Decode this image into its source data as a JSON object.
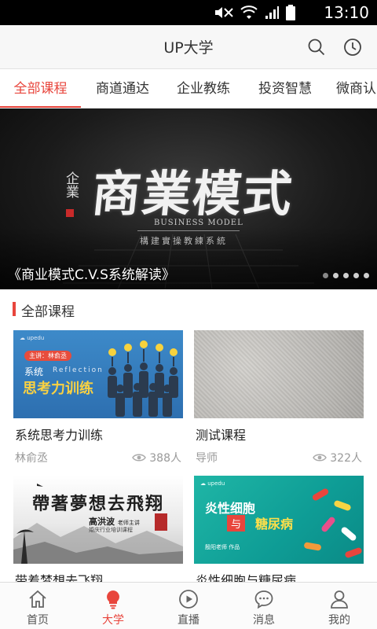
{
  "status_bar": {
    "time": "13:10"
  },
  "app_bar": {
    "title": "UP大学",
    "search_icon": "search-icon",
    "history_icon": "clock-icon"
  },
  "tabs": [
    {
      "label": "全部课程",
      "active": true
    },
    {
      "label": "商道通达",
      "active": false
    },
    {
      "label": "企业教练",
      "active": false
    },
    {
      "label": "投资智慧",
      "active": false
    },
    {
      "label": "微商认",
      "active": false
    }
  ],
  "banner": {
    "calligraphy": "商業模式",
    "brand": "企業",
    "subtitle_en": "BUSINESS MODEL",
    "subtitle_cn": "構建實操教練系統",
    "caption": "《商业模式C.V.S系统解读》",
    "slide_count": 5,
    "active_slide": 1
  },
  "section": {
    "title": "全部课程"
  },
  "courses": [
    {
      "title": "系统思考力训练",
      "author": "林俞丞",
      "views": "388人",
      "thumb": {
        "badge": "主讲：林俞丞",
        "sys": "系统",
        "ref": "Reflection",
        "big": "思考力训练"
      }
    },
    {
      "title": "测试课程",
      "author": "导师",
      "views": "322人"
    },
    {
      "title": "带着梦想去飞翔",
      "thumb": {
        "calligraphy": "帶著夢想去飛翔",
        "host": "高洪波",
        "host_role": "老师主讲",
        "meta": "婚庆行业培训课程"
      }
    },
    {
      "title": "炎性细胞与糖尿病",
      "thumb": {
        "line1": "炎性细胞",
        "mid": "与",
        "line2": "糖尿病",
        "doctor": "殷阳老师",
        "doctor_role": "作品"
      }
    }
  ],
  "bottom_nav": [
    {
      "label": "首页",
      "icon": "home-icon",
      "active": false
    },
    {
      "label": "大学",
      "icon": "lightbulb-icon",
      "active": true
    },
    {
      "label": "直播",
      "icon": "play-icon",
      "active": false
    },
    {
      "label": "消息",
      "icon": "message-icon",
      "active": false
    },
    {
      "label": "我的",
      "icon": "user-icon",
      "active": false
    }
  ],
  "colors": {
    "accent": "#e8453c",
    "muted": "#999999"
  }
}
